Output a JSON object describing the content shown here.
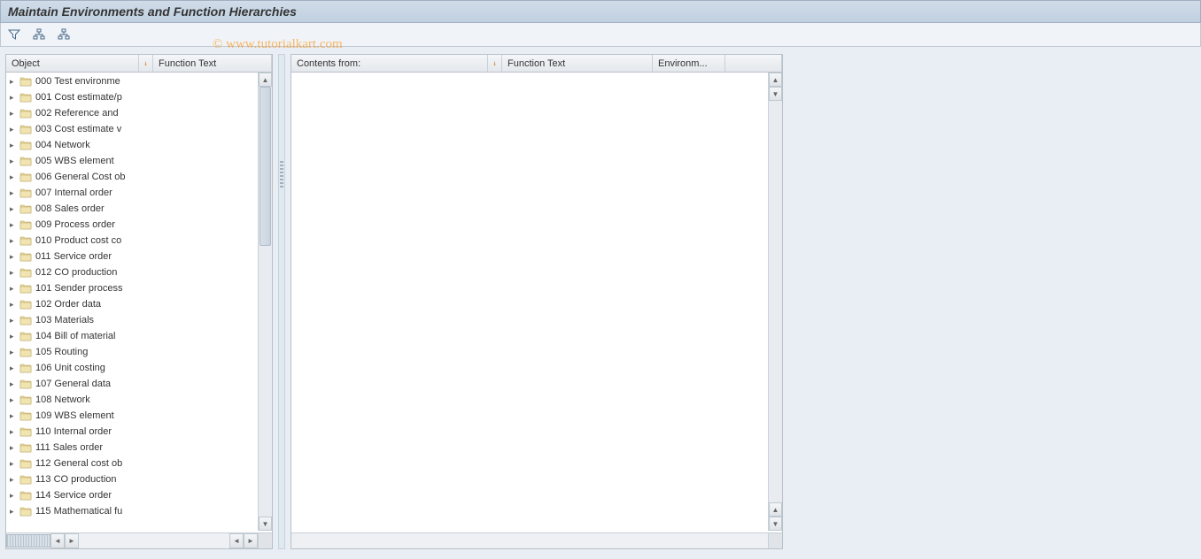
{
  "title": "Maintain Environments and Function Hierarchies",
  "watermark": "© www.tutorialkart.com",
  "leftPanel": {
    "headers": {
      "object": "Object",
      "functionText": "Function Text"
    },
    "items": [
      {
        "label": "000 Test environme"
      },
      {
        "label": "001 Cost estimate/p"
      },
      {
        "label": "002 Reference and"
      },
      {
        "label": "003 Cost estimate v"
      },
      {
        "label": "004 Network"
      },
      {
        "label": "005 WBS element"
      },
      {
        "label": "006 General Cost ob"
      },
      {
        "label": "007 Internal order"
      },
      {
        "label": "008 Sales order"
      },
      {
        "label": "009 Process order"
      },
      {
        "label": "010 Product cost co"
      },
      {
        "label": "011 Service order"
      },
      {
        "label": "012 CO production"
      },
      {
        "label": "101 Sender process"
      },
      {
        "label": "102 Order data"
      },
      {
        "label": "103 Materials"
      },
      {
        "label": "104 Bill of material"
      },
      {
        "label": "105 Routing"
      },
      {
        "label": "106 Unit costing"
      },
      {
        "label": "107 General data"
      },
      {
        "label": "108 Network"
      },
      {
        "label": "109 WBS element"
      },
      {
        "label": "110 Internal order"
      },
      {
        "label": "111 Sales order"
      },
      {
        "label": "112 General cost ob"
      },
      {
        "label": "113 CO production"
      },
      {
        "label": "114 Service order"
      },
      {
        "label": "115 Mathematical fu"
      }
    ]
  },
  "rightPanel": {
    "headers": {
      "contents": "Contents from:",
      "functionText": "Function Text",
      "environ": "Environm..."
    }
  }
}
